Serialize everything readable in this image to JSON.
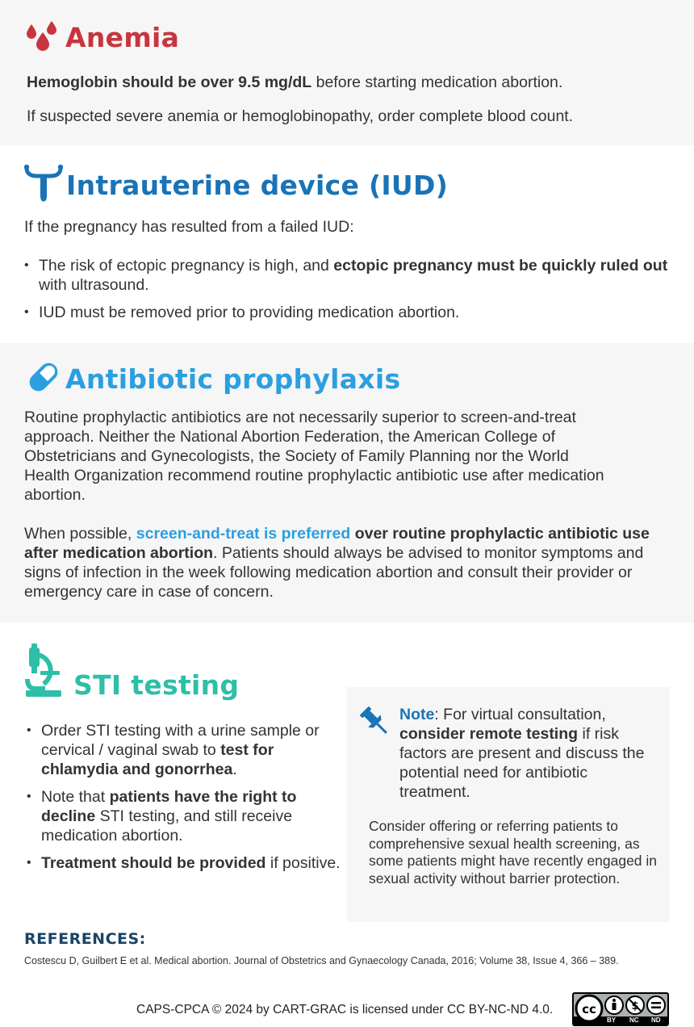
{
  "colors": {
    "anemia": "#c8353e",
    "iud": "#1a73b6",
    "antibiotic": "#2b9fe0",
    "sti": "#2dbfa7",
    "references": "#1a4466",
    "grey_bg": "#f6f6f6"
  },
  "anemia": {
    "icon": "blood-drops-icon",
    "title": "Anemia",
    "p1_bold": "Hemoglobin should be over 9.5 mg/dL",
    "p1_rest": " before starting medication abortion.",
    "p2": "If suspected severe anemia or hemoglobinopathy, order complete blood count."
  },
  "iud": {
    "icon": "iud-icon",
    "title": "Intrauterine device (IUD)",
    "intro": "If the pregnancy has resulted from a failed IUD:",
    "b1_pre": "The risk of ectopic pregnancy is high, and ",
    "b1_bold": "ectopic pregnancy must be quickly ruled out",
    "b1_post": " with ultrasound.",
    "b2": "IUD must be removed prior to providing medication abortion."
  },
  "antibiotic": {
    "icon": "pill-capsule-icon",
    "title": "Antibiotic prophylaxis",
    "p1": "Routine prophylactic antibiotics are not necessarily superior to screen-and-treat approach. Neither the National Abortion Federation, the American College of Obstetricians and Gynecologists, the Society of Family Planning nor the World Health Organization recommend routine prophylactic antibiotic use after medication abortion.",
    "p2_pre": "When possible, ",
    "p2_highlight": "screen-and-treat is preferred",
    "p2_bold": " over routine prophylactic antibiotic use after medication abortion",
    "p2_post": ". Patients should always be advised to monitor symptoms and signs of infection in the week following medication abortion and consult their provider or emergency care in case of concern."
  },
  "sti": {
    "icon": "microscope-icon",
    "title": "STI testing",
    "b1_pre": "Order STI testing with a urine sample or cervical / vaginal swab to ",
    "b1_bold": "test for chlamydia and gonorrhea",
    "b1_post": ".",
    "b2_pre": "Note that ",
    "b2_bold": "patients have the right to decline",
    "b2_post": " STI testing, and still receive medication abortion.",
    "b3_bold": "Treatment should be provided",
    "b3_post": " if positive."
  },
  "note": {
    "icon": "pushpin-icon",
    "label": "Note",
    "text_pre": ": For virtual consultation, ",
    "text_bold": "consider remote testing",
    "text_post": " if risk factors are present and discuss the potential need for antibiotic treatment.",
    "secondary": "Consider offering or referring patients to comprehensive sexual health screening, as some patients might have recently engaged in sexual activity without barrier protection."
  },
  "references": {
    "heading": "REFERENCES:",
    "citation": "Costescu D, Guilbert E et al.  Medical abortion. Journal of Obstetrics and Gynaecology Canada, 2016; Volume 38, Issue 4, 366 – 389."
  },
  "footer": {
    "license_text": "CAPS-CPCA © 2024 by CART-GRAC is licensed under CC BY-NC-ND 4.0.",
    "badge_icon": "cc-by-nc-nd-badge-icon",
    "badge_labels": [
      "BY",
      "NC",
      "ND"
    ]
  }
}
